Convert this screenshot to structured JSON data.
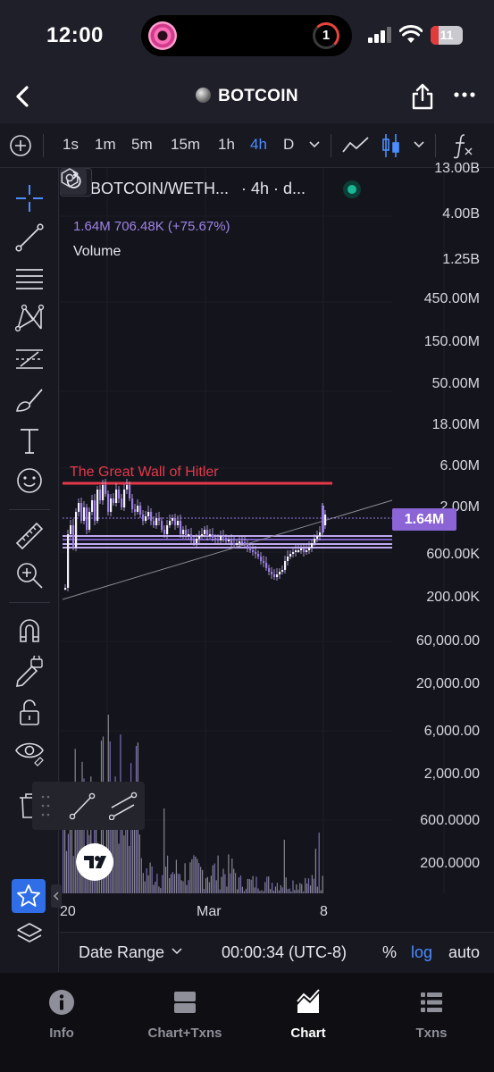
{
  "status_bar": {
    "time": "12:00",
    "island_badge": "1",
    "battery_level": "11"
  },
  "header": {
    "title": "BOTCOIN"
  },
  "toolbar": {
    "timeframes": [
      "1s",
      "1m",
      "5m",
      "15m",
      "1h",
      "4h",
      "D"
    ],
    "active_timeframe": "4h",
    "accent": "#4c8dff"
  },
  "legend": {
    "pair": "BOTCOIN/WETH...",
    "interval": "· 4h · d...",
    "values": "1.64M  706.48K (+75.67%)",
    "volume_label": "Volume"
  },
  "drawings": {
    "wall_label": "The Great Wall of Hitler",
    "wall_color": "#e5394a"
  },
  "chart_data": {
    "type": "candlestick",
    "y_scale": "log",
    "y_tick_labels": [
      "13.00B",
      "4.00B",
      "1.25B",
      "450.00M",
      "150.00M",
      "50.00M",
      "18.00M",
      "6.00M",
      "2.00M",
      "1.64M",
      "600.00K",
      "200.00K",
      "60,000.00",
      "20,000.00",
      "6,000.00",
      "2,000.00",
      "600.0000",
      "200.0000"
    ],
    "current_price_label": "1.64M",
    "x_tick_labels": [
      "20",
      "Mar",
      "8"
    ],
    "series_color": "#9b7be8",
    "volume_color": "#8c7bd0"
  },
  "bottom_bar": {
    "date_range": "Date Range",
    "clock": "00:00:34 (UTC-8)",
    "percent": "%",
    "log": "log",
    "auto": "auto"
  },
  "nav": {
    "items": [
      "Info",
      "Chart+Txns",
      "Chart",
      "Txns"
    ],
    "active": "Chart"
  }
}
